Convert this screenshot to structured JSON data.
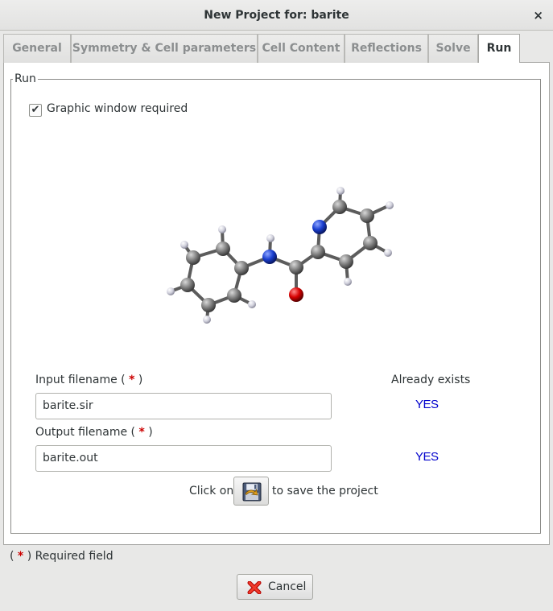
{
  "window": {
    "title": "New Project for: barite",
    "close_symbol": "×"
  },
  "tabs": [
    {
      "label": "General"
    },
    {
      "label": "Symmetry & Cell parameters"
    },
    {
      "label": "Cell Content"
    },
    {
      "label": "Reflections"
    },
    {
      "label": "Solve"
    },
    {
      "label": "Run",
      "active": true
    }
  ],
  "run": {
    "frame_title": "Run",
    "graphic_checkbox": {
      "label": "Graphic window required",
      "checked": true,
      "mark": "✔"
    },
    "already_exists_header": "Already exists",
    "input": {
      "label": "Input filename (",
      "star": "*",
      "label_close": ")",
      "value": "barite.sir",
      "exists": "YES"
    },
    "output": {
      "label": "Output filename (",
      "star": "*",
      "label_close": ")",
      "value": "barite.out",
      "exists": "YES"
    },
    "save_hint_before": "Click on",
    "save_hint_after": "to save the project"
  },
  "footer": {
    "required_open": "(",
    "required_star": "*",
    "required_text": ") Required field",
    "cancel_label": "Cancel"
  },
  "colors": {
    "required_star": "#cc0000",
    "yes_text": "#0000cc",
    "carbon": "#8a8a8a",
    "nitrogen": "#1a3fd0",
    "oxygen": "#d60000",
    "hydrogen": "#e4e4f0"
  }
}
